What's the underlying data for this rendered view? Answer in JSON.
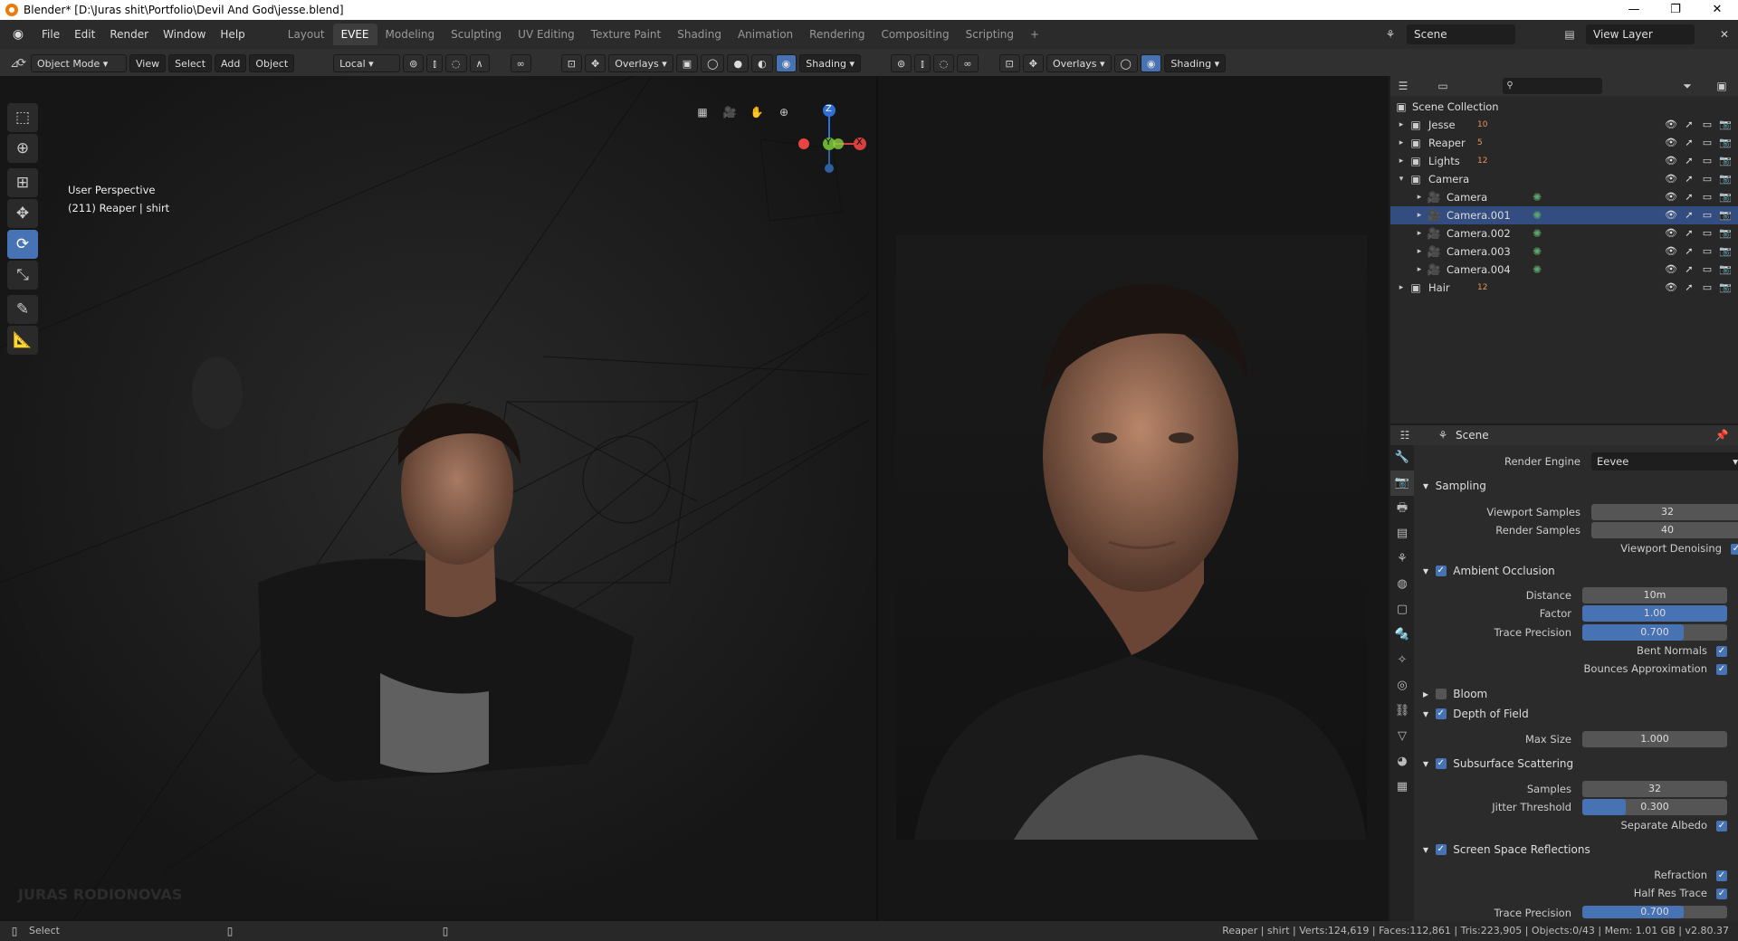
{
  "title": "Blender* [D:\\Juras shit\\Portfolio\\Devil And God\\jesse.blend]",
  "window_controls": {
    "min": "—",
    "max": "❐",
    "close": "✕"
  },
  "menus": [
    "File",
    "Edit",
    "Render",
    "Window",
    "Help"
  ],
  "workspaces": [
    "Layout",
    "EVEE",
    "Modeling",
    "Sculpting",
    "UV Editing",
    "Texture Paint",
    "Shading",
    "Animation",
    "Rendering",
    "Compositing",
    "Scripting"
  ],
  "active_workspace": "EVEE",
  "add_workspace": "+",
  "scene_name": "Scene",
  "view_layer": "View Layer",
  "viewport": {
    "mode": "Object Mode",
    "menus": [
      "View",
      "Select",
      "Add",
      "Object"
    ],
    "transform_orientation": "Local",
    "overlays": "Overlays",
    "shading": "Shading",
    "perspective": "User Perspective",
    "context": "(211) Reaper | shirt",
    "watermark": "JURAS RODIONOVAS"
  },
  "gizmo": {
    "z": "Z",
    "y": "Y",
    "x": "X"
  },
  "outliner": {
    "search_placeholder": "",
    "root": "Scene Collection",
    "rows": [
      {
        "name": "Jesse",
        "badge": "10"
      },
      {
        "name": "Reaper",
        "badge": "5"
      },
      {
        "name": "Lights",
        "badge": "12"
      },
      {
        "name": "Camera",
        "badge": ""
      },
      {
        "name": "Camera",
        "badge": ""
      },
      {
        "name": "Camera.001",
        "badge": ""
      },
      {
        "name": "Camera.002",
        "badge": ""
      },
      {
        "name": "Camera.003",
        "badge": ""
      },
      {
        "name": "Camera.004",
        "badge": ""
      },
      {
        "name": "Hair",
        "badge": "12"
      }
    ]
  },
  "properties": {
    "context": "Scene",
    "render_engine_label": "Render Engine",
    "render_engine": "Eevee",
    "sampling": "Sampling",
    "viewport_samples_label": "Viewport Samples",
    "viewport_samples": "32",
    "render_samples_label": "Render Samples",
    "render_samples": "40",
    "viewport_denoising": "Viewport Denoising",
    "ao": "Ambient Occlusion",
    "distance_label": "Distance",
    "distance": "10m",
    "factor_label": "Factor",
    "factor": "1.00",
    "factor_fraction": 1.0,
    "trace_precision_label": "Trace Precision",
    "trace_precision": "0.700",
    "trace_precision_fraction": 0.7,
    "bent_normals": "Bent Normals",
    "bounces_approx": "Bounces Approximation",
    "bloom": "Bloom",
    "dof": "Depth of Field",
    "max_size_label": "Max Size",
    "max_size": "1.000",
    "sss": "Subsurface Scattering",
    "samples_label": "Samples",
    "samples": "32",
    "jitter_label": "Jitter Threshold",
    "jitter": "0.300",
    "jitter_fraction": 0.3,
    "separate_albedo": "Separate Albedo",
    "ssr": "Screen Space Reflections",
    "refraction": "Refraction",
    "half_res": "Half Res Trace",
    "ssr_trace_label": "Trace Precision",
    "ssr_trace": "0.700"
  },
  "status": {
    "select": "Select",
    "stats": "Reaper | shirt | Verts:124,619 | Faces:112,861 | Tris:223,905 | Objects:0/43 | Mem: 1.01 GB | v2.80.37"
  },
  "colors": {
    "accent": "#4772b3",
    "selected_row": "#334d80",
    "header": "#303030"
  }
}
